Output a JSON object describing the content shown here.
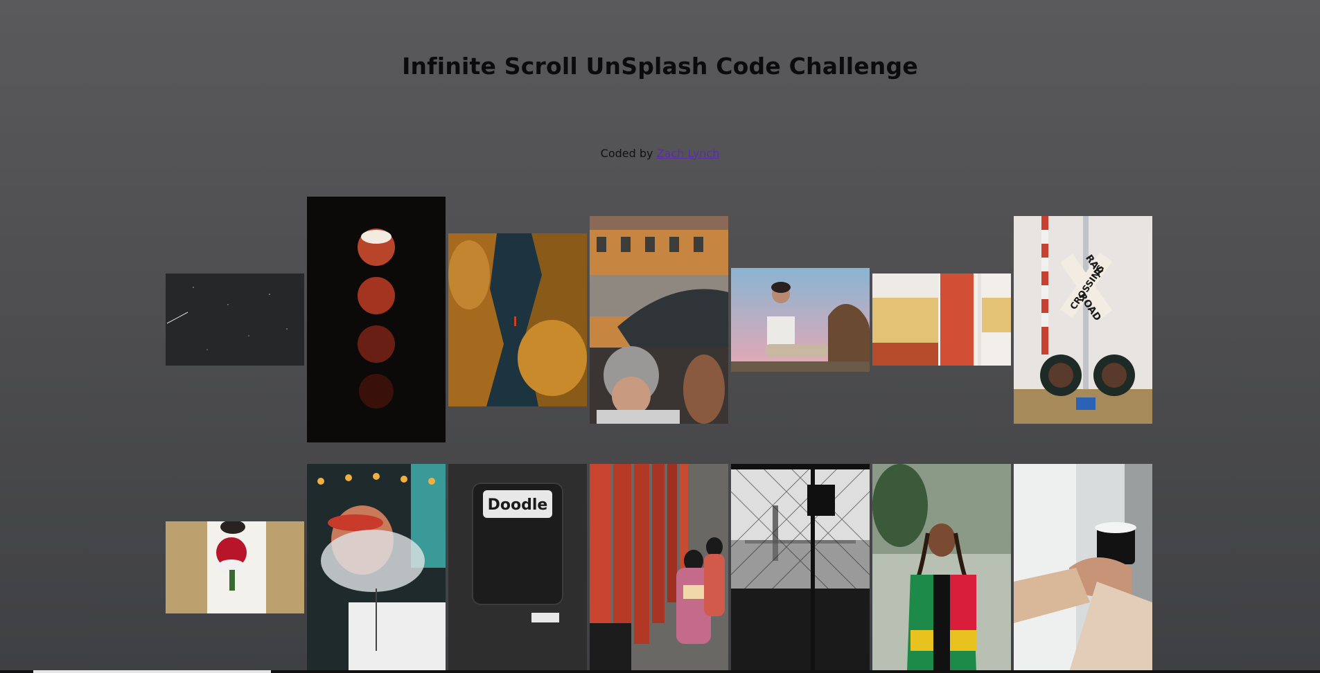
{
  "header": {
    "title": "Infinite Scroll UnSplash Code Challenge",
    "credit_prefix": "Coded by ",
    "credit_link": "Zach Lynch"
  },
  "gallery": {
    "row1": [
      {
        "subject": "night sky with shooting star"
      },
      {
        "subject": "lunar eclipse phases"
      },
      {
        "subject": "autumn trees along river"
      },
      {
        "subject": "crowd with umbrella before building"
      },
      {
        "subject": "young man sitting at sunset"
      },
      {
        "subject": "striped building wall"
      },
      {
        "subject": "railroad crossing sign",
        "sign_text": [
          "RAIL",
          "ROAD",
          "CROSSING"
        ]
      }
    ],
    "row2": [
      {
        "subject": "bride holding red roses"
      },
      {
        "subject": "man exhaling smoke"
      },
      {
        "subject": "doodle bar chalkboard",
        "sign_text": "Doodle"
      },
      {
        "subject": "kimono women at torii gates"
      },
      {
        "subject": "city skyline through fence"
      },
      {
        "subject": "woman in colorful jacket"
      },
      {
        "subject": "hand holding coffee cup"
      }
    ]
  },
  "scroll": {
    "progress_fraction": 0.18
  },
  "colors": {
    "background_top": "#5a5a5c",
    "background_bottom": "#3f4043",
    "title": "#0b0b0b",
    "link": "#5b2ea6"
  }
}
